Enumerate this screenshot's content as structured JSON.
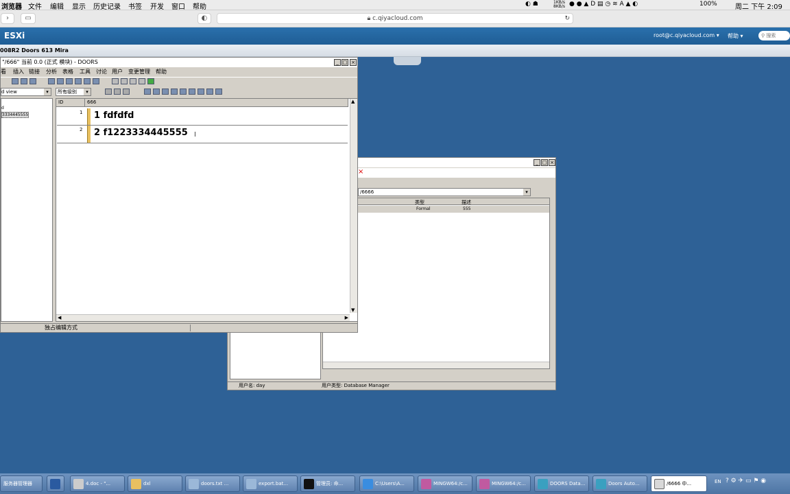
{
  "mac_menu": {
    "app": "浏览器",
    "items": [
      "文件",
      "编辑",
      "显示",
      "历史记录",
      "书签",
      "开发",
      "窗口",
      "帮助"
    ],
    "net_up": "1KB/s",
    "net_down": "8KB/s",
    "battery": "100%",
    "clock": "周二 下午 2:09"
  },
  "browser": {
    "url": "c.qiyacloud.com"
  },
  "esxi": {
    "product": "ESXi",
    "user": "root@c.qiyacloud.com ▾",
    "help": "帮助 ▾",
    "search_placeholder": "搜索",
    "vm_title": "008R2 Doors 613 Mira"
  },
  "doors_window": {
    "title": "\"/666\" 当前 0.0 (正式 模块) - DOORS",
    "menu": [
      "看",
      "插入",
      "链接",
      "分析",
      "表格",
      "工具",
      "讨论",
      "用户",
      "变更管理",
      "帮助"
    ],
    "view_select": "d view",
    "level_select": "所有级别",
    "tree_items": [
      "d",
      "3334445555"
    ],
    "col_id": "ID",
    "col_main": "666",
    "rows": [
      {
        "id": "1",
        "text": "1 fdfdfd"
      },
      {
        "id": "2",
        "text": "2 f1223334445555"
      }
    ],
    "status": "独占编辑方式"
  },
  "db_window": {
    "path": "/6666",
    "col_type": "类型",
    "col_desc": "描述",
    "row_type": "Formal",
    "row_desc": "555",
    "status_user": "用户名: day",
    "status_type": "用户类型: Database Manager"
  },
  "taskbar": {
    "start": "服务器管理器",
    "tasks": [
      "",
      "4.doc - \"...",
      "dxl",
      "doors.txt ...",
      "export.bat...",
      "管理员: 命...",
      "C:\\Users\\A...",
      "MINGW64:/c...",
      "MINGW64:/c...",
      "DOORS Data...",
      "Doors Auto...",
      "/6666 中..."
    ],
    "lang": "EN"
  }
}
